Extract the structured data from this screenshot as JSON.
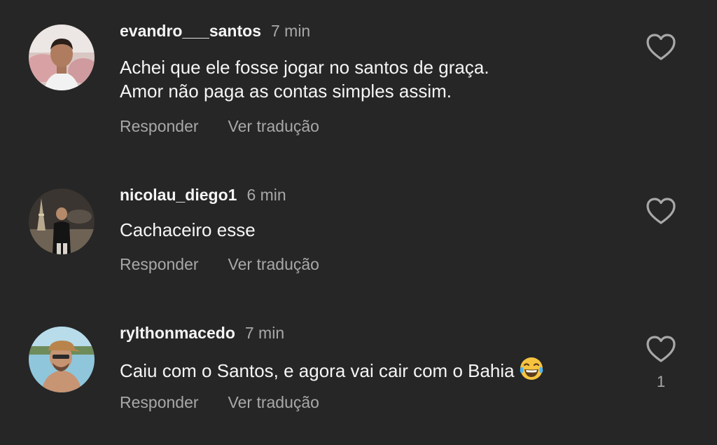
{
  "comments": [
    {
      "username": "evandro___santos",
      "time": "7 min",
      "lines": [
        "Achei que ele fosse jogar no santos de graça.",
        "Amor não paga as contas simples assim."
      ],
      "reply": "Responder",
      "translate": "Ver tradução",
      "likes": ""
    },
    {
      "username": "nicolau_diego1",
      "time": "6 min",
      "lines": [
        "Cachaceiro esse"
      ],
      "reply": "Responder",
      "translate": "Ver tradução",
      "likes": ""
    },
    {
      "username": "rylthonmacedo",
      "time": "7 min",
      "lines": [
        "Caiu com o Santos, e agora vai cair com o Bahia"
      ],
      "emoji": "face-with-tears-of-joy-icon",
      "reply": "Responder",
      "translate": "Ver tradução",
      "likes": "1"
    }
  ],
  "colors": {
    "background": "#262626",
    "primary_text": "#f5f5f5",
    "secondary_text": "#a8a8a8"
  }
}
